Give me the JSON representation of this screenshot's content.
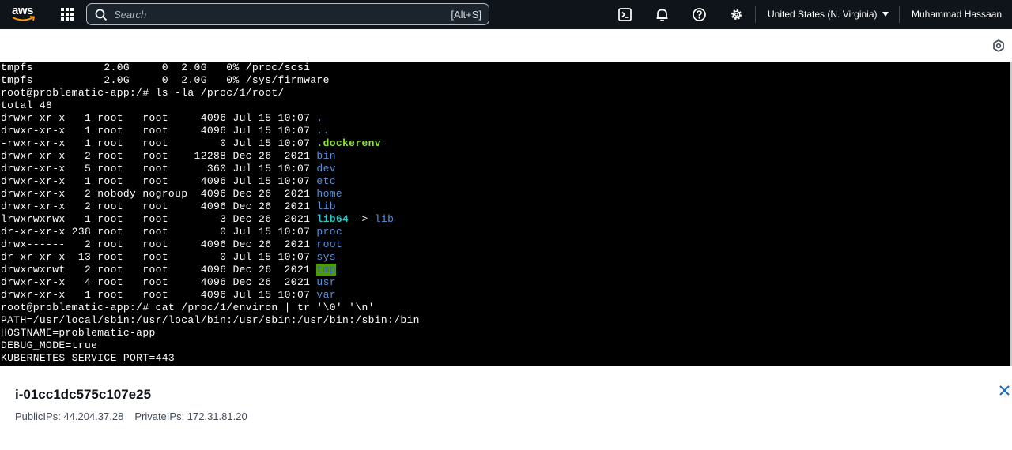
{
  "nav": {
    "logo_text": "aws",
    "search_placeholder": "Search",
    "search_shortcut": "[Alt+S]",
    "region": "United States (N. Virginia)",
    "user": "Muhammad Hassaan",
    "icons": [
      "cloudshell-icon",
      "bell-icon",
      "help-icon",
      "gear-icon"
    ]
  },
  "terminal": {
    "lines": [
      [
        {
          "t": "tmpfs           2.0G     0  2.0G   0% /proc/scsi"
        }
      ],
      [
        {
          "t": "tmpfs           2.0G     0  2.0G   0% /sys/firmware"
        }
      ],
      [
        {
          "t": "root@problematic-app:/# ls -la /proc/1/root/"
        }
      ],
      [
        {
          "t": "total 48"
        }
      ],
      [
        {
          "t": "drwxr-xr-x   1 root   root     4096 Jul 15 10:07 "
        },
        {
          "t": ".",
          "c": "dir"
        }
      ],
      [
        {
          "t": "drwxr-xr-x   1 root   root     4096 Jul 15 10:07 "
        },
        {
          "t": "..",
          "c": "dir"
        }
      ],
      [
        {
          "t": "-rwxr-xr-x   1 root   root        0 Jul 15 10:07 "
        },
        {
          "t": ".dockerenv",
          "c": "exe"
        }
      ],
      [
        {
          "t": "drwxr-xr-x   2 root   root    12288 Dec 26  2021 "
        },
        {
          "t": "bin",
          "c": "dir"
        }
      ],
      [
        {
          "t": "drwxr-xr-x   5 root   root      360 Jul 15 10:07 "
        },
        {
          "t": "dev",
          "c": "dir"
        }
      ],
      [
        {
          "t": "drwxr-xr-x   1 root   root     4096 Jul 15 10:07 "
        },
        {
          "t": "etc",
          "c": "dir"
        }
      ],
      [
        {
          "t": "drwxr-xr-x   2 nobody nogroup  4096 Dec 26  2021 "
        },
        {
          "t": "home",
          "c": "dir"
        }
      ],
      [
        {
          "t": "drwxr-xr-x   2 root   root     4096 Dec 26  2021 "
        },
        {
          "t": "lib",
          "c": "dir"
        }
      ],
      [
        {
          "t": "lrwxrwxrwx   1 root   root        3 Dec 26  2021 "
        },
        {
          "t": "lib64",
          "c": "link"
        },
        {
          "t": " -> "
        },
        {
          "t": "lib",
          "c": "dir"
        }
      ],
      [
        {
          "t": "dr-xr-xr-x 238 root   root        0 Jul 15 10:07 "
        },
        {
          "t": "proc",
          "c": "dir"
        }
      ],
      [
        {
          "t": "drwx------   2 root   root     4096 Dec 26  2021 "
        },
        {
          "t": "root",
          "c": "dir"
        }
      ],
      [
        {
          "t": "dr-xr-xr-x  13 root   root        0 Jul 15 10:07 "
        },
        {
          "t": "sys",
          "c": "dir"
        }
      ],
      [
        {
          "t": "drwxrwxrwt   2 root   root     4096 Dec 26  2021 "
        },
        {
          "t": "tmp",
          "c": "tmp"
        }
      ],
      [
        {
          "t": "drwxr-xr-x   4 root   root     4096 Dec 26  2021 "
        },
        {
          "t": "usr",
          "c": "dir"
        }
      ],
      [
        {
          "t": "drwxr-xr-x   1 root   root     4096 Jul 15 10:07 "
        },
        {
          "t": "var",
          "c": "dir"
        }
      ],
      [
        {
          "t": "root@problematic-app:/# cat /proc/1/environ | tr '\\0' '\\n'"
        }
      ],
      [
        {
          "t": "PATH=/usr/local/sbin:/usr/local/bin:/usr/sbin:/usr/bin:/sbin:/bin"
        }
      ],
      [
        {
          "t": "HOSTNAME=problematic-app"
        }
      ],
      [
        {
          "t": "DEBUG_MODE=true"
        }
      ],
      [
        {
          "t": "KUBERNETES_SERVICE_PORT=443"
        }
      ]
    ],
    "colors": {
      "background": "#000000",
      "text": "#ffffff",
      "dir": "#5b8fd6",
      "exe": "#8ae234",
      "link": "#34c6c8",
      "tmp_bg": "#4e9a06"
    }
  },
  "panel": {
    "instance_id": "i-01cc1dc575c107e25",
    "public_ips": "PublicIPs: 44.204.37.28",
    "private_ips": "PrivateIPs: 172.31.81.20"
  }
}
